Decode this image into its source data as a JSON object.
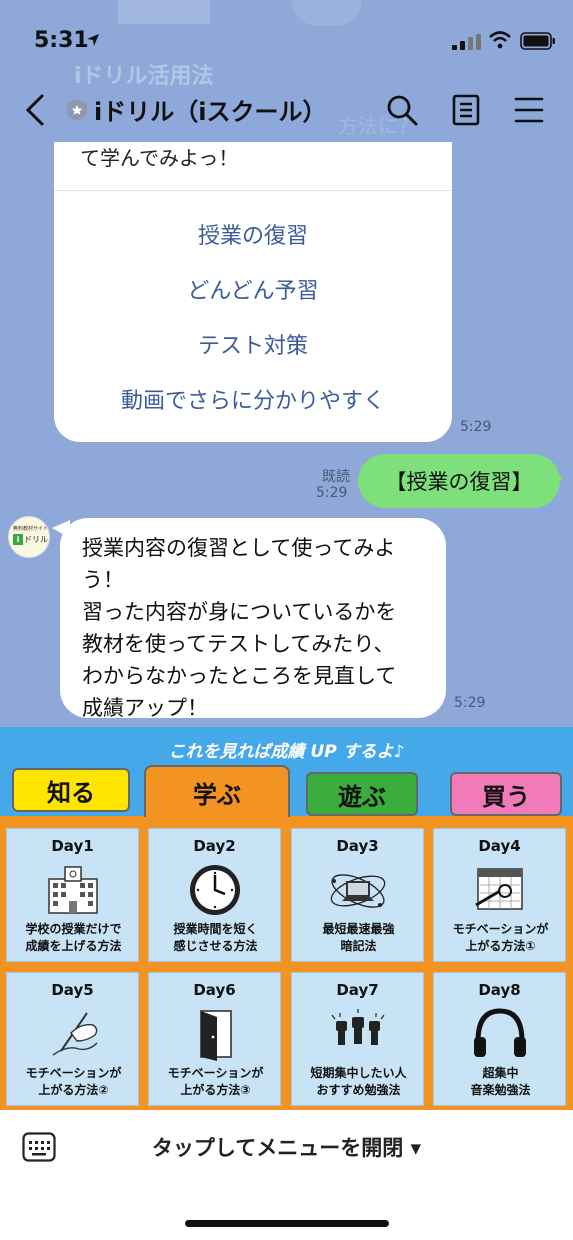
{
  "status": {
    "time": "5:31"
  },
  "header": {
    "title": "iドリル（iスクール）"
  },
  "background": {
    "ghost_title": "iドリル活用法",
    "ghost_text": "方法に？"
  },
  "card": {
    "top_text": "て学んでみよっ！",
    "links": [
      "授業の復習",
      "どんどん予習",
      "テスト対策",
      "動画でさらに分かりやすく"
    ],
    "time": "5:29"
  },
  "sent": {
    "read_label": "既読",
    "time": "5:29",
    "text": "【授業の復習】"
  },
  "avatar": {
    "small": "無料教材サイト",
    "name": "ドリル",
    "letter": "i"
  },
  "received": {
    "lines": [
      "授業内容の復習として使ってみよ",
      "う！",
      "習った内容が身についているかを",
      "教材を使ってテストしてみたり、",
      "わからなかったところを見直して",
      "成績アップ！"
    ],
    "time": "5:29"
  },
  "rich_menu": {
    "banner": "これを見れば成績 UP するよ♪",
    "tabs": [
      {
        "label": "知る",
        "color": "#ffe500"
      },
      {
        "label": "学ぶ",
        "color": "#f39322"
      },
      {
        "label": "遊ぶ",
        "color": "#3aad3c"
      },
      {
        "label": "買う",
        "color": "#f27ab8"
      }
    ],
    "days": [
      {
        "title": "Day1",
        "line1": "学校の授業だけで",
        "line2": "成績を上げる方法",
        "icon": "school-building-icon"
      },
      {
        "title": "Day2",
        "line1": "授業時間を短く",
        "line2": "感じさせる方法",
        "icon": "clock-icon"
      },
      {
        "title": "Day3",
        "line1": "最短最速最強",
        "line2": "暗記法",
        "icon": "laptop-orbit-icon"
      },
      {
        "title": "Day4",
        "line1": "モチベーションが",
        "line2": "上がる方法①",
        "icon": "calendar-pen-icon"
      },
      {
        "title": "Day5",
        "line1": "モチベーションが",
        "line2": "上がる方法②",
        "icon": "hand-writing-icon"
      },
      {
        "title": "Day6",
        "line1": "モチベーションが",
        "line2": "上がる方法③",
        "icon": "door-icon"
      },
      {
        "title": "Day7",
        "line1": "短期集中したい人",
        "line2": "おすすめ勉強法",
        "icon": "raised-fists-icon"
      },
      {
        "title": "Day8",
        "line1": "超集中",
        "line2": "音楽勉強法",
        "icon": "headphones-icon"
      }
    ]
  },
  "bottom": {
    "menu_toggle": "タップしてメニューを開閉 ▾"
  }
}
